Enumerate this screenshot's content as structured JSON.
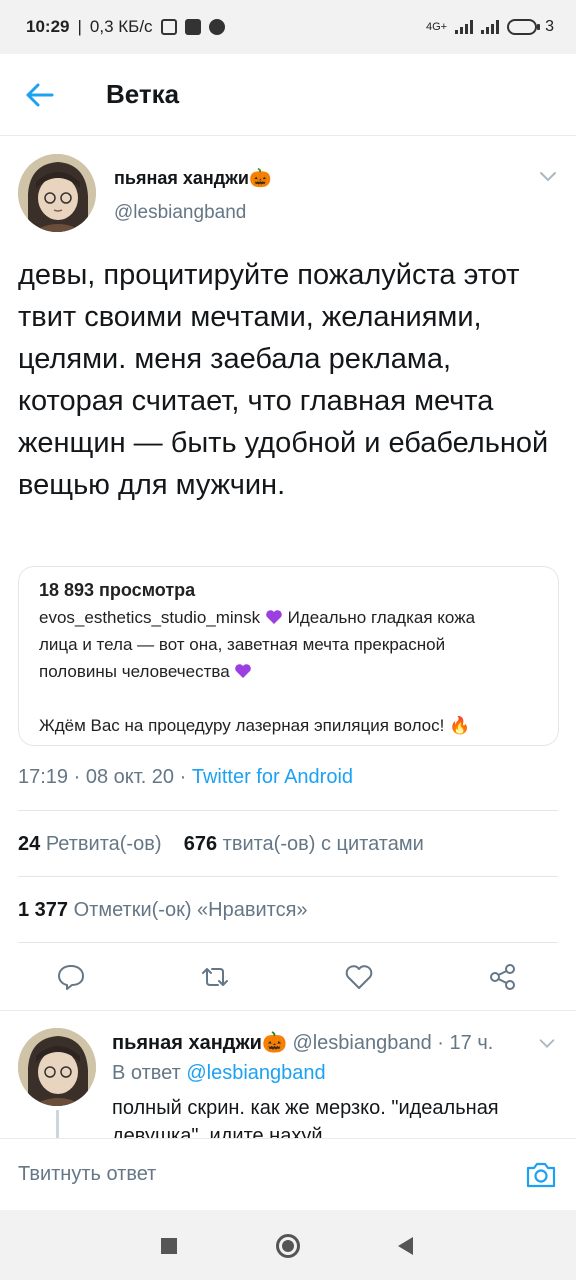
{
  "status_bar": {
    "time": "10:29",
    "speed": "0,3 КБ/с",
    "network": "4G+",
    "battery": "3"
  },
  "header": {
    "title": "Ветка"
  },
  "tweet": {
    "author_name": "пьяная ханджи🎃",
    "author_handle": "@lesbiangband",
    "text": "девы, процитируйте пожалуйста этот твит своими мечтами, желаниями, целями. меня заебала реклама, которая считает, что главная мечта женщин — быть удобной и ебабельной вещью для мужчин.",
    "quote": {
      "views": "18 893 просмотра",
      "username": "evos_esthetics_studio_minsk",
      "line1": "Идеально гладкая кожа",
      "line2": "лица и тела — вот она, заветная мечта прекрасной",
      "line3": "половины человечества",
      "line4": "Ждём Вас на процедуру лазерная эпиляция волос! 🔥"
    },
    "time": "17:19",
    "date": "08 окт. 20",
    "source": "Twitter for Android",
    "retweets_count": "24",
    "retweets_label": "Ретвита(-ов)",
    "quotes_count": "676",
    "quotes_label": "твита(-ов) с цитатами",
    "likes_count": "1 377",
    "likes_label": "Отметки(-ок) «Нравится»"
  },
  "reply": {
    "author_name": "пьяная ханджи🎃",
    "author_handle": "@lesbiangband",
    "age": "17 ч.",
    "replying_label": "В ответ",
    "replying_to": "@lesbiangband",
    "text": "полный скрин. как же мерзко. \"идеальная девушка\", идите нахуй"
  },
  "composer": {
    "placeholder": "Твитнуть ответ"
  },
  "colors": {
    "accent": "#1da1f2",
    "secondary_text": "#657786",
    "border": "#e1e8ed"
  },
  "icons": {
    "back": "arrow-left-icon",
    "chevron": "chevron-down-icon",
    "reply": "reply-icon",
    "retweet": "retweet-icon",
    "like": "heart-icon",
    "share": "share-icon",
    "camera": "camera-icon"
  }
}
